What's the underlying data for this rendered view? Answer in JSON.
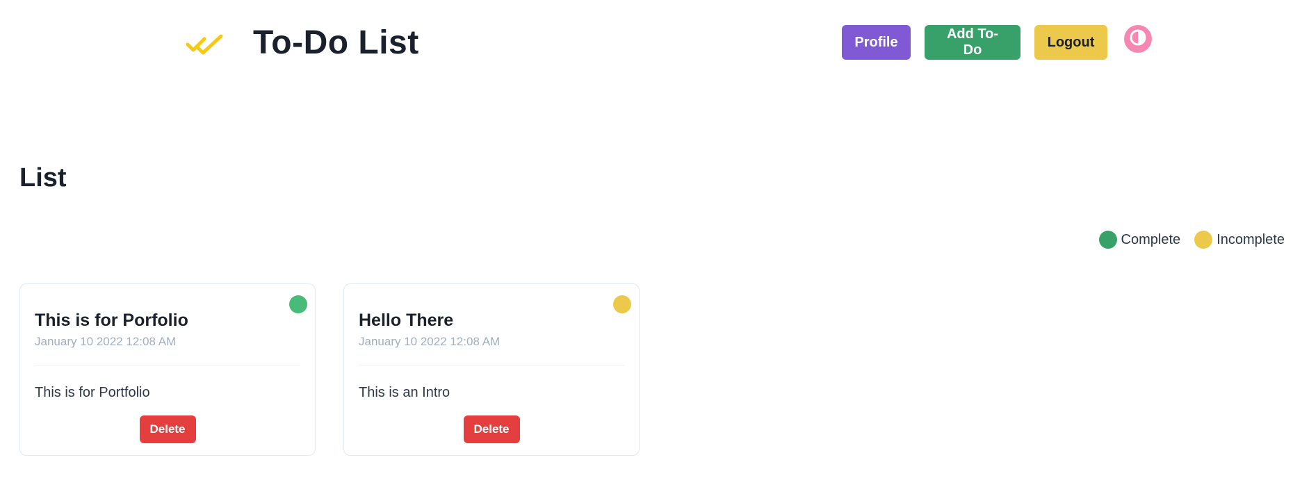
{
  "header": {
    "title": "To-Do List",
    "logo_icon": "double-check-icon",
    "logo_color": "#f6c915",
    "nav": {
      "profile_label": "Profile",
      "add_label": "Add To-Do",
      "logout_label": "Logout",
      "theme_toggle_icon": "half-circle-contrast-icon"
    }
  },
  "colors": {
    "profile": "#805ad5",
    "add": "#38a169",
    "logout": "#ecc94b",
    "theme_toggle": "#f687b3",
    "complete": "#38a169",
    "incomplete": "#ecc94b",
    "delete": "#e53e3e"
  },
  "list": {
    "heading": "List",
    "legend": [
      {
        "label": "Complete",
        "color": "#38a169"
      },
      {
        "label": "Incomplete",
        "color": "#ecc94b"
      }
    ],
    "cards": [
      {
        "title": "This is for Porfolio",
        "date": "January 10 2022 12:08 AM",
        "body": "This is for Portfolio",
        "status": "complete",
        "status_color": "#48bb78",
        "delete_label": "Delete"
      },
      {
        "title": "Hello There",
        "date": "January 10 2022 12:08 AM",
        "body": "This is an Intro",
        "status": "incomplete",
        "status_color": "#ecc94b",
        "delete_label": "Delete"
      }
    ]
  }
}
